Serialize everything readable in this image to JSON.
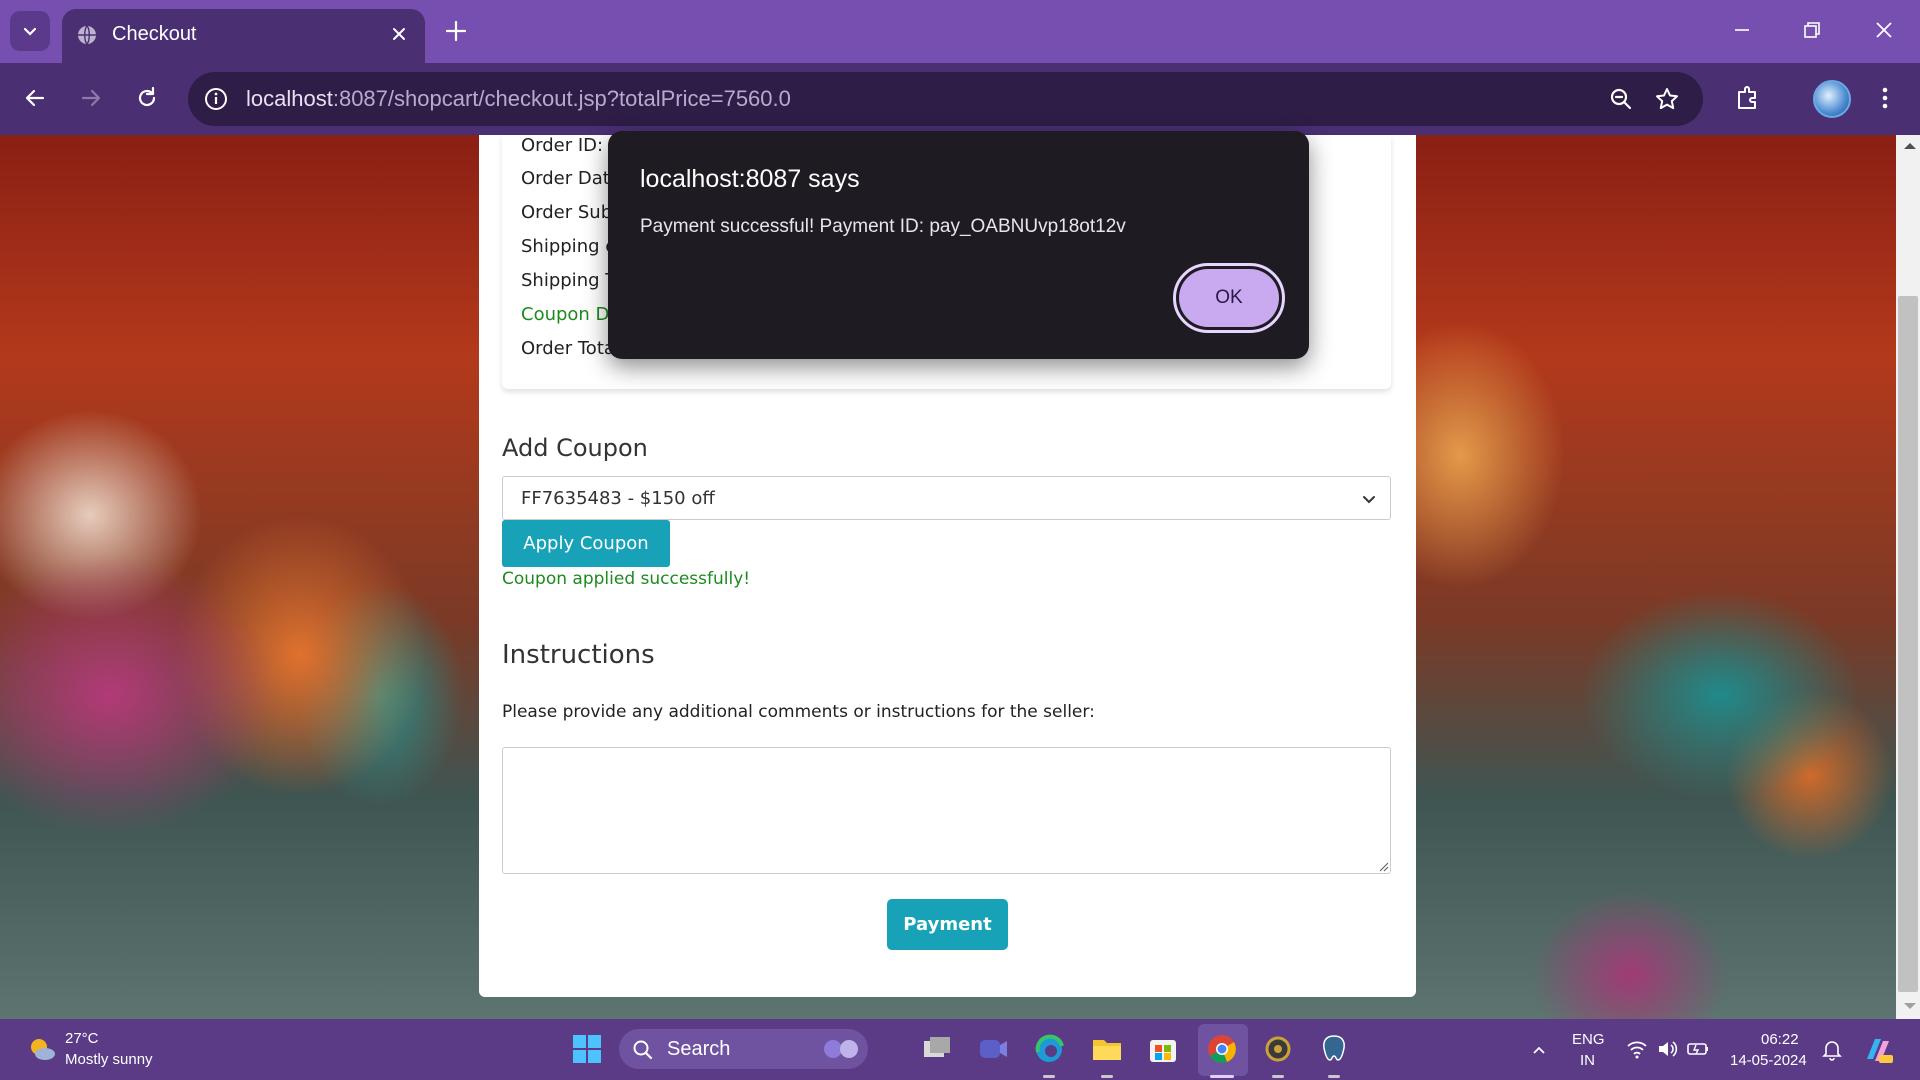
{
  "browser": {
    "tab_title": "Checkout",
    "url_host": "localhost",
    "url_rest": ":8087/shopcart/checkout.jsp?totalPrice=7560.0"
  },
  "order_summary": {
    "lines": [
      "Order ID:",
      "Order Dat",
      "Order Sub",
      "Shipping c",
      "Shipping T",
      "Coupon D",
      "Order Tota"
    ]
  },
  "coupon": {
    "heading": "Add Coupon",
    "selected": "FF7635483 - $150 off",
    "apply_label": "Apply Coupon",
    "success_msg": "Coupon applied successfully!"
  },
  "instructions": {
    "heading": "Instructions",
    "label": "Please provide any additional comments or instructions for the seller:",
    "value": ""
  },
  "payment_label": "Payment",
  "dialog": {
    "title": "localhost:8087 says",
    "message": "Payment successful! Payment ID: pay_OABNUvp18ot12v",
    "ok_label": "OK"
  },
  "taskbar": {
    "weather_temp": "27°C",
    "weather_desc": "Mostly sunny",
    "search_placeholder": "Search",
    "lang_top": "ENG",
    "lang_bottom": "IN",
    "time": "06:22",
    "date": "14-05-2024"
  },
  "colors": {
    "accent_button": "#17a2b8",
    "success_text": "#1e8a1e",
    "browser_frame": "#764fb0",
    "dialog_ok": "#c9a9f0"
  }
}
